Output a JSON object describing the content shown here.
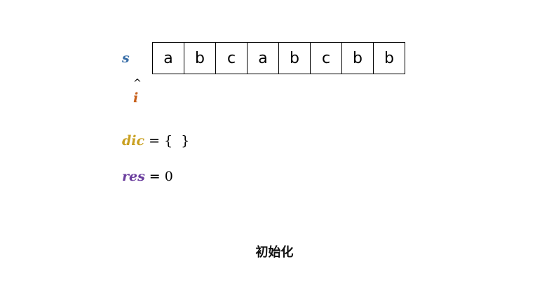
{
  "string": {
    "label": "s",
    "chars": [
      "a",
      "b",
      "c",
      "a",
      "b",
      "c",
      "b",
      "b"
    ]
  },
  "pointer": {
    "caret": "^",
    "label": "i",
    "index": 0
  },
  "dic": {
    "name": "dic",
    "value": "= {  }"
  },
  "res": {
    "name": "res",
    "value": "= 0"
  },
  "caption": "初始化",
  "colors": {
    "s": "#3a6fa8",
    "i": "#c8611c",
    "dic": "#c9a021",
    "res": "#6b3e9e"
  }
}
